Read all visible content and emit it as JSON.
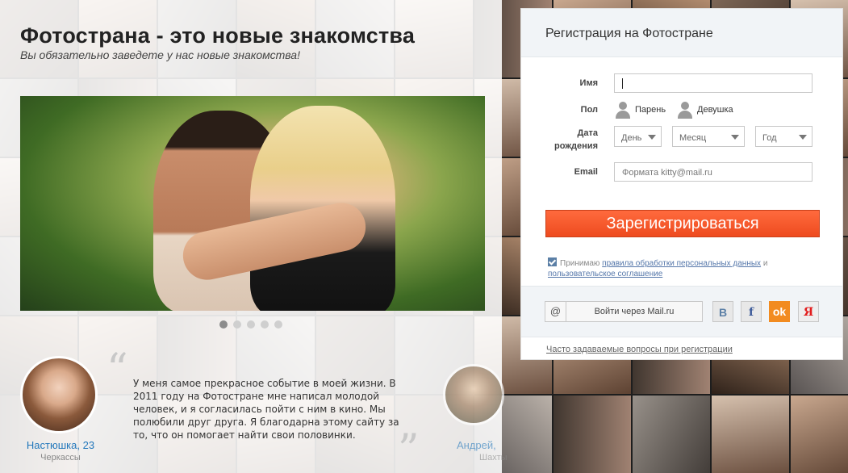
{
  "hero": {
    "title": "Фотострана - это новые знакомства",
    "subtitle": "Вы обязательно заведете у нас новые знакомства!"
  },
  "slider": {
    "dot_count": 5,
    "active_dot": 1
  },
  "testimonial": {
    "text": "У меня самое прекрасное событие в моей жизни. В 2011 году на Фотостране мне написал молодой человек, и я согласилась пойти с ним в кино. Мы полюбили друг друга. Я благодарна этому сайту за то, что он помогает найти свои половинки.",
    "open_quote": "“",
    "close_quote": "”",
    "author_name": "Настюшка, 23",
    "author_city": "Черкассы",
    "next_author_name": "Андрей,",
    "next_author_city": "Шахты"
  },
  "registration": {
    "title": "Регистрация на Фотостране",
    "name_label": "Имя",
    "name_value": "",
    "gender_label": "Пол",
    "gender_male": "Парень",
    "gender_female": "Девушка",
    "birth_label_1": "Дата",
    "birth_label_2": "рождения",
    "day_select": "День",
    "month_select": "Месяц",
    "year_select": "Год",
    "email_label": "Email",
    "email_placeholder": "Формата kitty@mail.ru",
    "submit_label": "Зарегистрироваться",
    "agree_prefix": "Принимаю",
    "agree_link_rules": "правила обработки персональных данных",
    "agree_and": "и",
    "agree_link_terms": "пользовательское соглашение",
    "mailru_icon": "@",
    "mailru_label": "Войти через Mail.ru",
    "vk_glyph": "В",
    "fb_glyph": "f",
    "ok_glyph": "ok",
    "ya_glyph": "Я",
    "faq_link": "Часто задаваемые вопросы при регистрации"
  },
  "colors": {
    "accent_orange": "#ee4b1f",
    "link_blue": "#2277bb",
    "ok_orange": "#f28b20"
  }
}
